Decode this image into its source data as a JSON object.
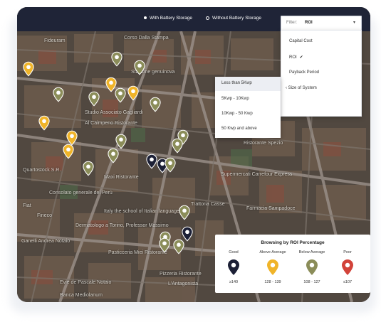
{
  "header": {
    "toggle_with": "With Battery Storage",
    "toggle_without": "Without Battery Storage"
  },
  "filter": {
    "label": "Filter:",
    "value": "ROI",
    "chevron": "▾",
    "options": [
      "Capital Cost",
      "ROI",
      "Payback Period",
      "Size of System"
    ],
    "selected_mark": "✔",
    "submenu_prefix": "‹"
  },
  "size_submenu": [
    "Less than 5Kwp",
    "5Kwp - 10Kwp",
    "10Kwp - 50 Kwp",
    "50 Kwp and above"
  ],
  "legend": {
    "title": "Browsing by ROI Percentage",
    "categories": [
      {
        "label": "Good",
        "range": "≥140",
        "color": "#1c2036"
      },
      {
        "label": "Above Average",
        "range": "128 - 139",
        "color": "#f0b429"
      },
      {
        "label": "Below Average",
        "range": "108 - 127",
        "color": "#8b8d59"
      },
      {
        "label": "Poor",
        "range": "≤107",
        "color": "#d2433a"
      }
    ]
  },
  "map_labels": [
    "Fideuram",
    "Corso Dalla Stampa",
    "Stazione genuinova",
    "Studio Associato Gagliardi",
    "Al Caimpeno Ristorante",
    "Quartostock S.R.",
    "Consolato generale del Perù",
    "Ristorante Spezio",
    "Supermercati Carrefour Express",
    "Trattoria Casse",
    "Maxi Ristorante",
    "Fiat",
    "Fineco",
    "Ganelli Andrea Notaio",
    "Italy the school of Italian language",
    "Dermatologo a Torino, Professor Massimo",
    "Pasticceria Miei Ristorante",
    "Evie de Pascale Notaio",
    "Banca Mediolanum",
    "Farmacia Sampadoce",
    "L'Antagonista",
    "Pizzeria Ristorante"
  ],
  "pins": [
    {
      "color": "#f0b429"
    },
    {
      "color": "#8b8d59"
    },
    {
      "color": "#8b8d59"
    },
    {
      "color": "#8b8d59"
    },
    {
      "color": "#f0b429"
    },
    {
      "color": "#8b8d59"
    },
    {
      "color": "#f0b429"
    },
    {
      "color": "#8b8d59"
    },
    {
      "color": "#8b8d59"
    },
    {
      "color": "#f0b429"
    },
    {
      "color": "#f0b429"
    },
    {
      "color": "#f0b429"
    },
    {
      "color": "#8b8d59"
    },
    {
      "color": "#8b8d59"
    },
    {
      "color": "#8b8d59"
    },
    {
      "color": "#8b8d59"
    },
    {
      "color": "#1c2036"
    },
    {
      "color": "#1c2036"
    },
    {
      "color": "#8b8d59"
    },
    {
      "color": "#8b8d59"
    },
    {
      "color": "#8b8d59"
    },
    {
      "color": "#8b8d59"
    },
    {
      "color": "#1c2036"
    },
    {
      "color": "#8b8d59"
    },
    {
      "color": "#8b8d59"
    }
  ]
}
